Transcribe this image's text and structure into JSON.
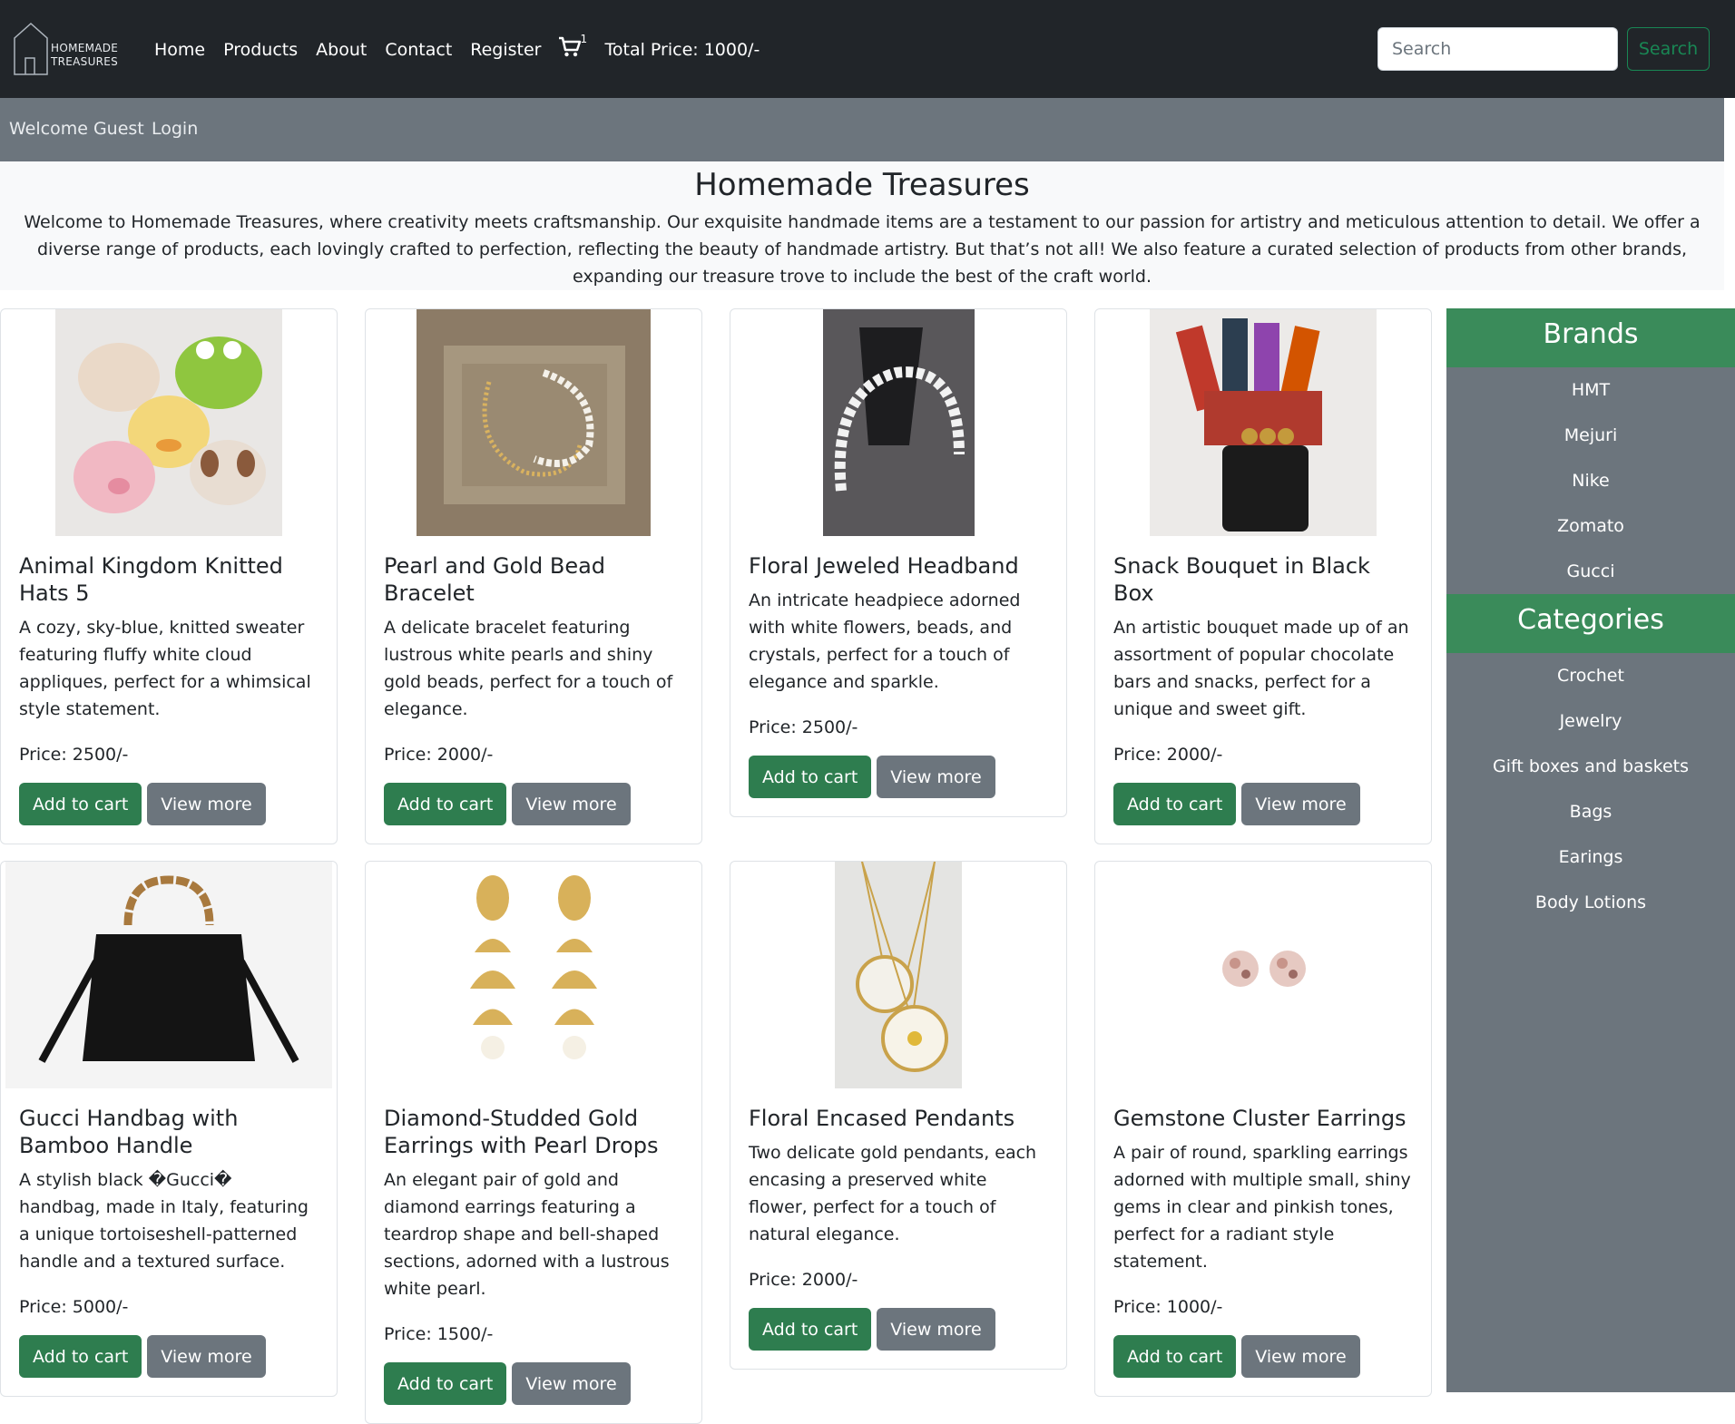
{
  "brand": {
    "line1": "HOMEMADE",
    "line2": "TREASURES"
  },
  "nav": {
    "links": [
      "Home",
      "Products",
      "About",
      "Contact",
      "Register"
    ],
    "cart_count": "1",
    "total_price": "Total Price: 1000/-",
    "search_placeholder": "Search",
    "search_button": "Search"
  },
  "subbar": {
    "welcome": "Welcome Guest",
    "login": "Login"
  },
  "intro": {
    "title": "Homemade Treasures",
    "text": "Welcome to Homemade Treasures, where creativity meets craftsmanship. Our exquisite handmade items are a testament to our passion for artistry and meticulous attention to detail. We offer a diverse range of products, each lovingly crafted to perfection, reflecting the beauty of handmade artistry. But that’s not all! We also feature a curated selection of products from other brands, expanding our treasure trove to include the best of the craft world."
  },
  "products": [
    {
      "title": "Animal Kingdom Knitted Hats 5",
      "desc": "A cozy, sky-blue, knitted sweater featuring fluffy white cloud appliques, perfect for a whimsical style statement.",
      "price": "Price: 2500/-",
      "add": "Add to cart",
      "view": "View more"
    },
    {
      "title": "Pearl and Gold Bead Bracelet",
      "desc": "A delicate bracelet featuring lustrous white pearls and shiny gold beads, perfect for a touch of elegance.",
      "price": "Price: 2000/-",
      "add": "Add to cart",
      "view": "View more"
    },
    {
      "title": "Floral Jeweled Headband",
      "desc": "An intricate headpiece adorned with white flowers, beads, and crystals, perfect for a touch of elegance and sparkle.",
      "price": "Price: 2500/-",
      "add": "Add to cart",
      "view": "View more"
    },
    {
      "title": "Snack Bouquet in Black Box",
      "desc": "An artistic bouquet made up of an assortment of popular chocolate bars and snacks, perfect for a unique and sweet gift.",
      "price": "Price: 2000/-",
      "add": "Add to cart",
      "view": "View more"
    },
    {
      "title": "Gucci Handbag with Bamboo Handle",
      "desc": "A stylish black �Gucci� handbag, made in Italy, featuring a unique tortoiseshell-patterned handle and a textured surface.",
      "price": "Price: 5000/-",
      "add": "Add to cart",
      "view": "View more"
    },
    {
      "title": "Diamond-Studded Gold Earrings with Pearl Drops",
      "desc": "An elegant pair of gold and diamond earrings featuring a teardrop shape and bell-shaped sections, adorned with a lustrous white pearl.",
      "price": "Price: 1500/-",
      "add": "Add to cart",
      "view": "View more"
    },
    {
      "title": "Floral Encased Pendants",
      "desc": "Two delicate gold pendants, each encasing a preserved white flower, perfect for a touch of natural elegance.",
      "price": "Price: 2000/-",
      "add": "Add to cart",
      "view": "View more"
    },
    {
      "title": "Gemstone Cluster Earrings",
      "desc": "A pair of round, sparkling earrings adorned with multiple small, shiny gems in clear and pinkish tones, perfect for a radiant style statement.",
      "price": "Price: 1000/-",
      "add": "Add to cart",
      "view": "View more"
    }
  ],
  "sidebar": {
    "brands_title": "Brands",
    "brands": [
      "HMT",
      "Mejuri",
      "Nike",
      "Zomato",
      "Gucci"
    ],
    "categories_title": "Categories",
    "categories": [
      "Crochet",
      "Jewelry",
      "Gift boxes and baskets",
      "Bags",
      "Earings",
      "Body Lotions"
    ]
  },
  "colors": {
    "navbar": "#212529",
    "subbar": "#6c757d",
    "accent_green": "#2e7d4f",
    "sidebar_head": "#3a8b5a"
  }
}
